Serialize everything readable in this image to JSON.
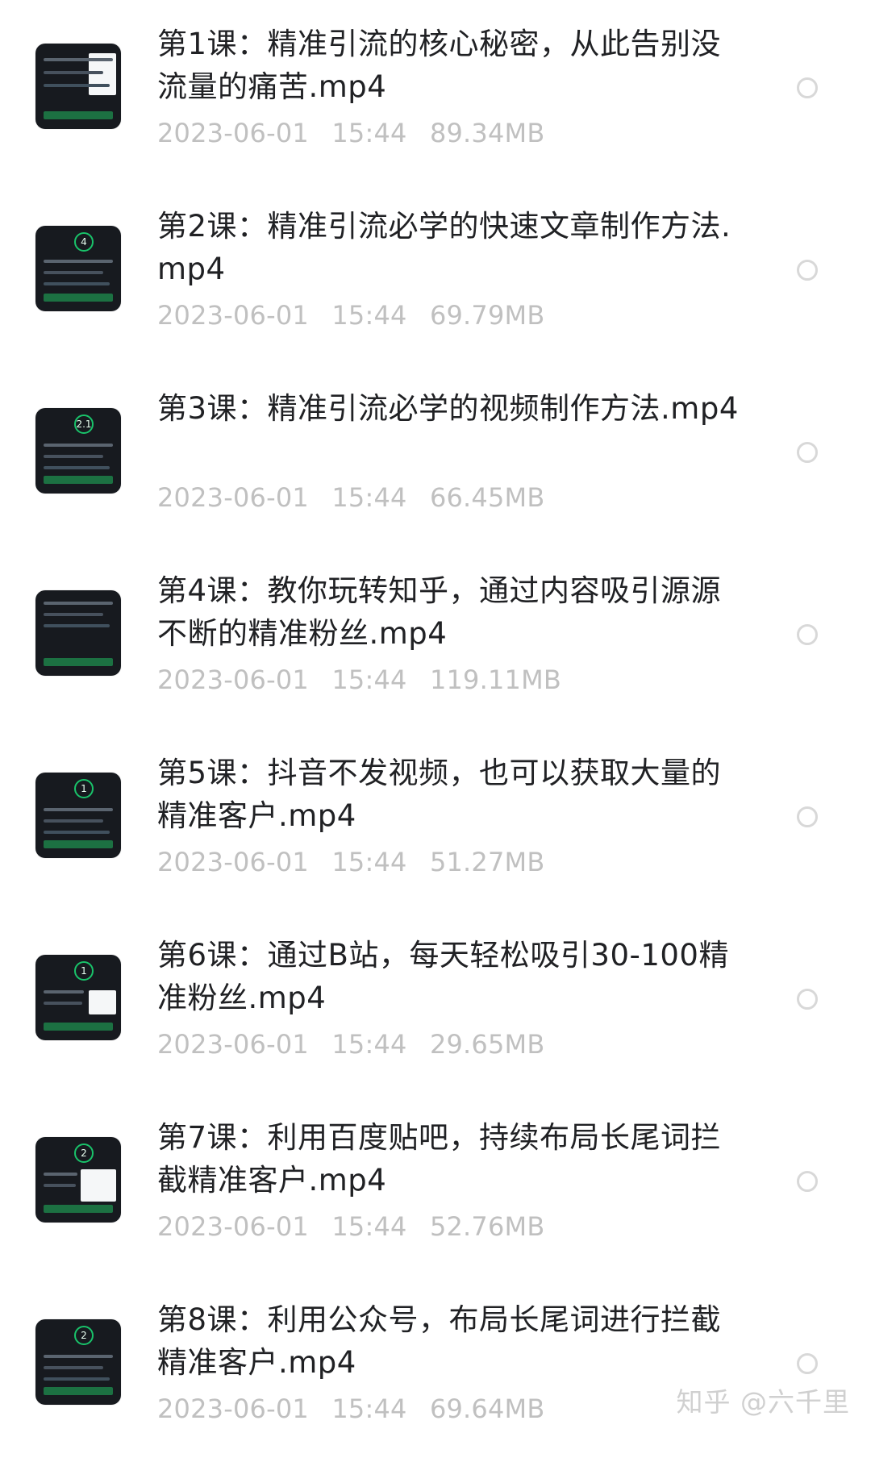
{
  "file_list": [
    {
      "title": "第1课：精准引流的核心秘密，从此告别没流量的痛苦.mp4",
      "date": "2023-06-01",
      "time": "15:44",
      "size": "89.34MB"
    },
    {
      "title": "第2课：精准引流必学的快速文章制作方法.mp4",
      "date": "2023-06-01",
      "time": "15:44",
      "size": "69.79MB"
    },
    {
      "title": "第3课：精准引流必学的视频制作方法.mp4",
      "date": "2023-06-01",
      "time": "15:44",
      "size": "66.45MB"
    },
    {
      "title": "第4课：教你玩转知乎，通过内容吸引源源不断的精准粉丝.mp4",
      "date": "2023-06-01",
      "time": "15:44",
      "size": "119.11MB"
    },
    {
      "title": "第5课：抖音不发视频，也可以获取大量的精准客户.mp4",
      "date": "2023-06-01",
      "time": "15:44",
      "size": "51.27MB"
    },
    {
      "title": "第6课：通过B站，每天轻松吸引30-100精准粉丝.mp4",
      "date": "2023-06-01",
      "time": "15:44",
      "size": "29.65MB"
    },
    {
      "title": "第7课：利用百度贴吧，持续布局长尾词拦截精准客户.mp4",
      "date": "2023-06-01",
      "time": "15:44",
      "size": "52.76MB"
    },
    {
      "title": "第8课：利用公众号，布局长尾词进行拦截精准客户.mp4",
      "date": "2023-06-01",
      "time": "15:44",
      "size": "69.64MB"
    }
  ],
  "watermark": "知乎 @六千里"
}
